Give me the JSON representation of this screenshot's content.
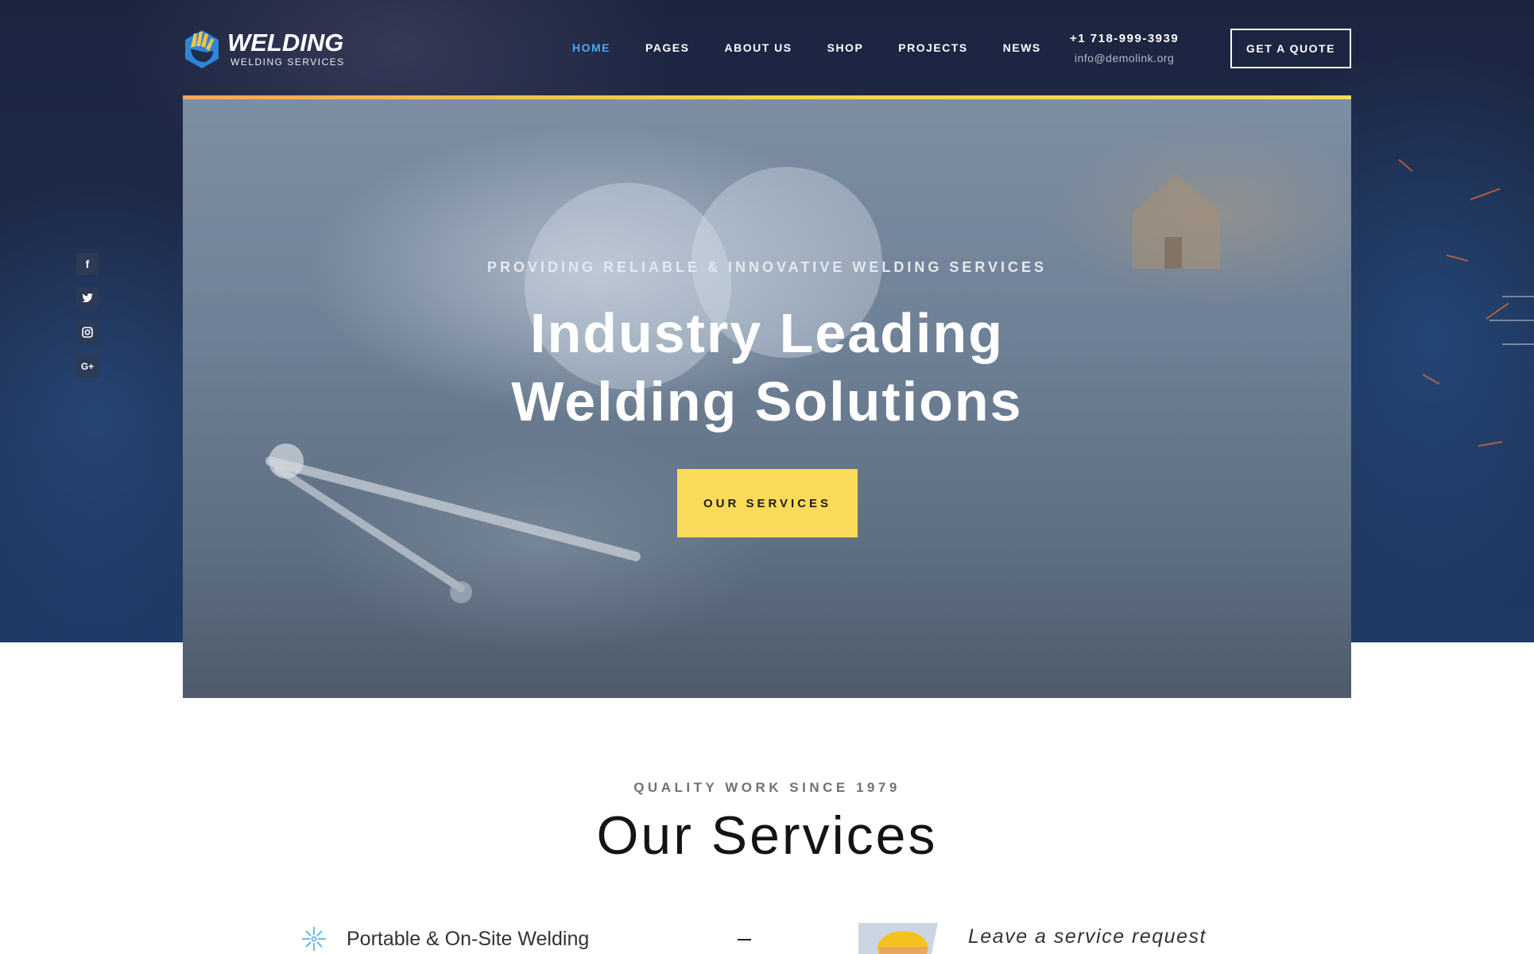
{
  "header": {
    "logo_title": "WELDING",
    "logo_subtitle": "WELDING SERVICES",
    "nav": [
      {
        "label": "HOME",
        "active": true
      },
      {
        "label": "PAGES",
        "active": false
      },
      {
        "label": "ABOUT US",
        "active": false
      },
      {
        "label": "SHOP",
        "active": false
      },
      {
        "label": "PROJECTS",
        "active": false
      },
      {
        "label": "NEWS",
        "active": false
      }
    ],
    "phone": "+1 718-999-3939",
    "email": "info@demolink.org",
    "quote_button": "GET A QUOTE"
  },
  "social": [
    {
      "icon": "facebook-icon",
      "glyph": "f"
    },
    {
      "icon": "twitter-icon",
      "glyph": "t"
    },
    {
      "icon": "instagram-icon",
      "glyph": "◘"
    },
    {
      "icon": "google-plus-icon",
      "glyph": "G+"
    }
  ],
  "hero": {
    "kicker": "PROVIDING RELIABLE & INNOVATIVE WELDING SERVICES",
    "title_line1": "Industry Leading",
    "title_line2": "Welding Solutions",
    "button": "OUR SERVICES"
  },
  "services": {
    "kicker": "QUALITY WORK SINCE 1979",
    "title": "Our Services",
    "first_item": {
      "label": "Portable & On-Site Welding",
      "icon": "spark-icon"
    },
    "request_label": "Leave a service request"
  },
  "colors": {
    "accent_blue": "#4aa8f0",
    "accent_yellow": "#fbdc5a",
    "dark_bg": "#1e2b4b"
  }
}
